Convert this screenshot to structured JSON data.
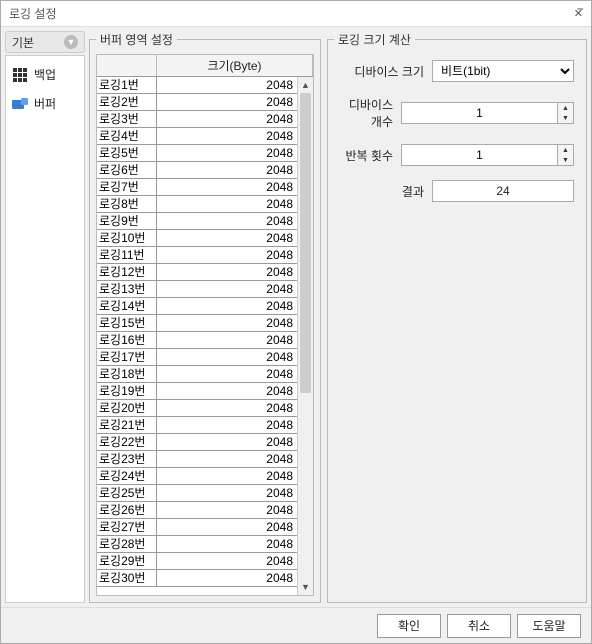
{
  "title": "로깅 설정",
  "sidebar": {
    "header": "기본",
    "items": [
      {
        "label": "백업"
      },
      {
        "label": "버퍼"
      }
    ]
  },
  "buffer_panel": {
    "legend": "버퍼 영역 설정",
    "header_size": "크기(Byte)",
    "rows": [
      {
        "label": "로깅1번",
        "size": "2048"
      },
      {
        "label": "로깅2번",
        "size": "2048"
      },
      {
        "label": "로깅3번",
        "size": "2048"
      },
      {
        "label": "로깅4번",
        "size": "2048"
      },
      {
        "label": "로깅5번",
        "size": "2048"
      },
      {
        "label": "로깅6번",
        "size": "2048"
      },
      {
        "label": "로깅7번",
        "size": "2048"
      },
      {
        "label": "로깅8번",
        "size": "2048"
      },
      {
        "label": "로깅9번",
        "size": "2048"
      },
      {
        "label": "로깅10번",
        "size": "2048"
      },
      {
        "label": "로깅11번",
        "size": "2048"
      },
      {
        "label": "로깅12번",
        "size": "2048"
      },
      {
        "label": "로깅13번",
        "size": "2048"
      },
      {
        "label": "로깅14번",
        "size": "2048"
      },
      {
        "label": "로깅15번",
        "size": "2048"
      },
      {
        "label": "로깅16번",
        "size": "2048"
      },
      {
        "label": "로깅17번",
        "size": "2048"
      },
      {
        "label": "로깅18번",
        "size": "2048"
      },
      {
        "label": "로깅19번",
        "size": "2048"
      },
      {
        "label": "로깅20번",
        "size": "2048"
      },
      {
        "label": "로깅21번",
        "size": "2048"
      },
      {
        "label": "로깅22번",
        "size": "2048"
      },
      {
        "label": "로깅23번",
        "size": "2048"
      },
      {
        "label": "로깅24번",
        "size": "2048"
      },
      {
        "label": "로깅25번",
        "size": "2048"
      },
      {
        "label": "로깅26번",
        "size": "2048"
      },
      {
        "label": "로깅27번",
        "size": "2048"
      },
      {
        "label": "로깅28번",
        "size": "2048"
      },
      {
        "label": "로깅29번",
        "size": "2048"
      },
      {
        "label": "로깅30번",
        "size": "2048"
      }
    ]
  },
  "calc_panel": {
    "legend": "로깅 크기 계산",
    "device_size_label": "디바이스 크기",
    "device_size_value": "비트(1bit)",
    "device_count_label": "디바이스 개수",
    "device_count_value": "1",
    "repeat_label": "반복 횟수",
    "repeat_value": "1",
    "result_label": "결과",
    "result_value": "24"
  },
  "footer": {
    "ok": "확인",
    "cancel": "취소",
    "help": "도움말"
  }
}
